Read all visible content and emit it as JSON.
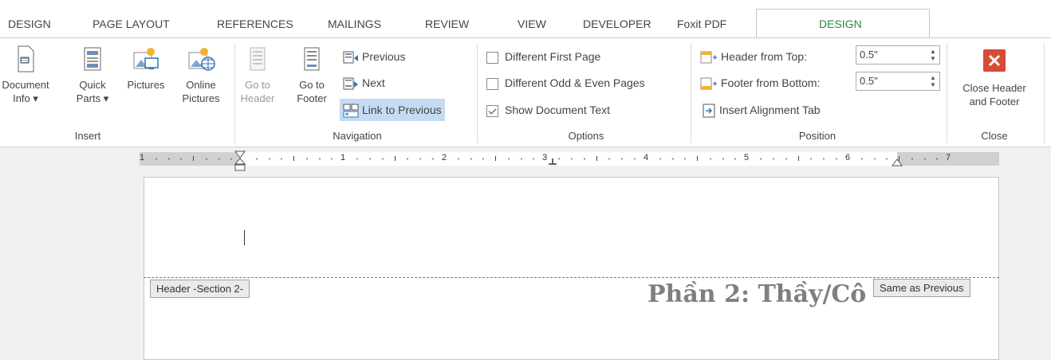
{
  "tabs": [
    "DESIGN",
    "PAGE LAYOUT",
    "REFERENCES",
    "MAILINGS",
    "REVIEW",
    "VIEW",
    "DEVELOPER",
    "Foxit PDF",
    "DESIGN"
  ],
  "insert_group": {
    "label": "Insert",
    "document_info": {
      "line1": "Document",
      "line2": "Info ▾"
    },
    "quick_parts": {
      "line1": "Quick",
      "line2": "Parts ▾"
    },
    "pictures": {
      "line1": "Pictures"
    },
    "online_pictures": {
      "line1": "Online",
      "line2": "Pictures"
    }
  },
  "navigation_group": {
    "label": "Navigation",
    "go_to_header": {
      "line1": "Go to",
      "line2": "Header"
    },
    "go_to_footer": {
      "line1": "Go to",
      "line2": "Footer"
    },
    "previous": "Previous",
    "next": "Next",
    "link_to_previous": "Link to Previous"
  },
  "options_group": {
    "label": "Options",
    "different_first_page": "Different First Page",
    "different_odd_even": "Different Odd & Even Pages",
    "show_document_text": "Show Document Text",
    "different_first_page_checked": false,
    "different_odd_even_checked": false,
    "show_document_text_checked": true
  },
  "position_group": {
    "label": "Position",
    "header_from_top": "Header from Top:",
    "header_from_top_value": "0.5\"",
    "footer_from_bottom": "Footer from Bottom:",
    "footer_from_bottom_value": "0.5\"",
    "insert_alignment_tab": "Insert Alignment Tab"
  },
  "close_group": {
    "label": "Close",
    "close_button": {
      "line1": "Close Header",
      "line2": "and Footer"
    }
  },
  "ruler": {
    "numbers": [
      "1",
      "1",
      "2",
      "3",
      "4",
      "5",
      "6",
      "7"
    ]
  },
  "document": {
    "header_tag": "Header -Section 2-",
    "same_as_previous_tag": "Same as Previous",
    "heading": "Phần 2: Thầy/Cô"
  },
  "colors": {
    "accent_green": "#2b8a3e",
    "close_red": "#d74a38",
    "link_highlight": "#c5dbf3"
  }
}
